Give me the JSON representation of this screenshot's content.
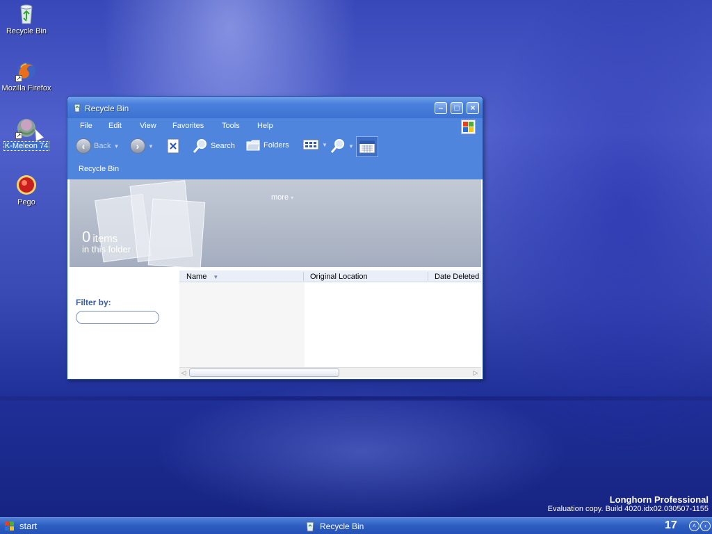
{
  "desktop": {
    "icons": [
      {
        "label": "Recycle Bin",
        "icon": "recycle-bin-icon"
      },
      {
        "label": "Mozilla Firefox",
        "icon": "firefox-icon"
      },
      {
        "label": "K-Meleon 74",
        "icon": "k-meleon-icon"
      },
      {
        "label": "Pego",
        "icon": "pego-icon"
      }
    ],
    "watermark": {
      "edition": "Longhorn Professional",
      "build": "Evaluation copy. Build 4020.idx02.030507-1155"
    }
  },
  "window": {
    "title": "Recycle Bin",
    "menu": [
      "File",
      "Edit",
      "View",
      "Favorites",
      "Tools",
      "Help"
    ],
    "toolbar": {
      "back": "Back",
      "search": "Search",
      "folders": "Folders"
    },
    "address": "Recycle Bin",
    "header": {
      "more": "more",
      "count": "0",
      "unit": "items",
      "subtitle": "in this folder"
    },
    "filter": {
      "label": "Filter by:",
      "value": ""
    },
    "columns": [
      "Name",
      "Original Location",
      "Date Deleted"
    ]
  },
  "taskbar": {
    "start": "start",
    "task": "Recycle Bin",
    "clock": "17"
  },
  "colors": {
    "window_blue": "#4f85dc",
    "taskbar_blue": "#2c5dc0",
    "accent_label": "#3a5dab"
  }
}
